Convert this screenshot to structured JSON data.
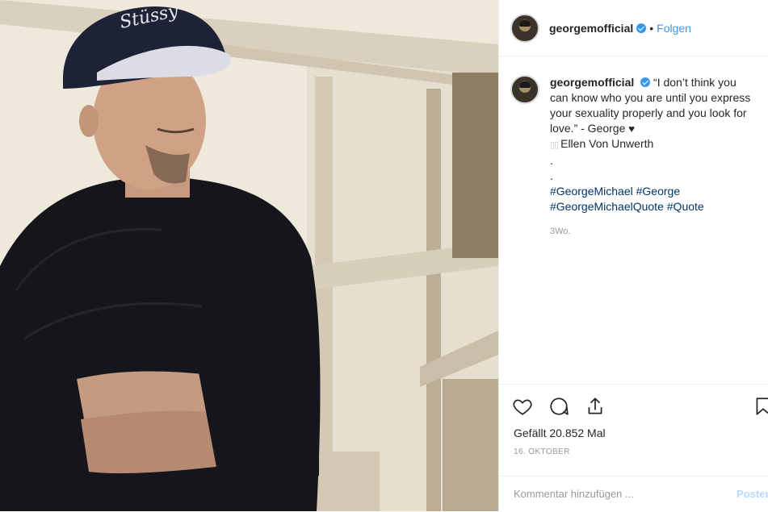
{
  "header": {
    "username": "georgemofficial",
    "separator": "•",
    "follow_label": "Folgen"
  },
  "caption": {
    "username": "georgemofficial",
    "quote": "“I don’t think you can know who you are until you express your sexuality properly and you look for love.” - George",
    "heart": "♥",
    "camera": "📷",
    "credit": "Ellen Von Unwerth",
    "dot1": ".",
    "dot2": ".",
    "tags": [
      "#GeorgeMichael",
      "#George",
      "#GeorgeMichaelQuote",
      "#Quote"
    ],
    "time": "3Wo."
  },
  "actions": {
    "likes": "Gefällt 20.852 Mal",
    "date": "16. OKTOBER",
    "comment_placeholder": "Kommentar hinzufügen ...",
    "post_label": "Posten"
  },
  "icons": [
    "heart-icon",
    "comment-icon",
    "share-icon",
    "bookmark-icon",
    "verified-icon"
  ]
}
